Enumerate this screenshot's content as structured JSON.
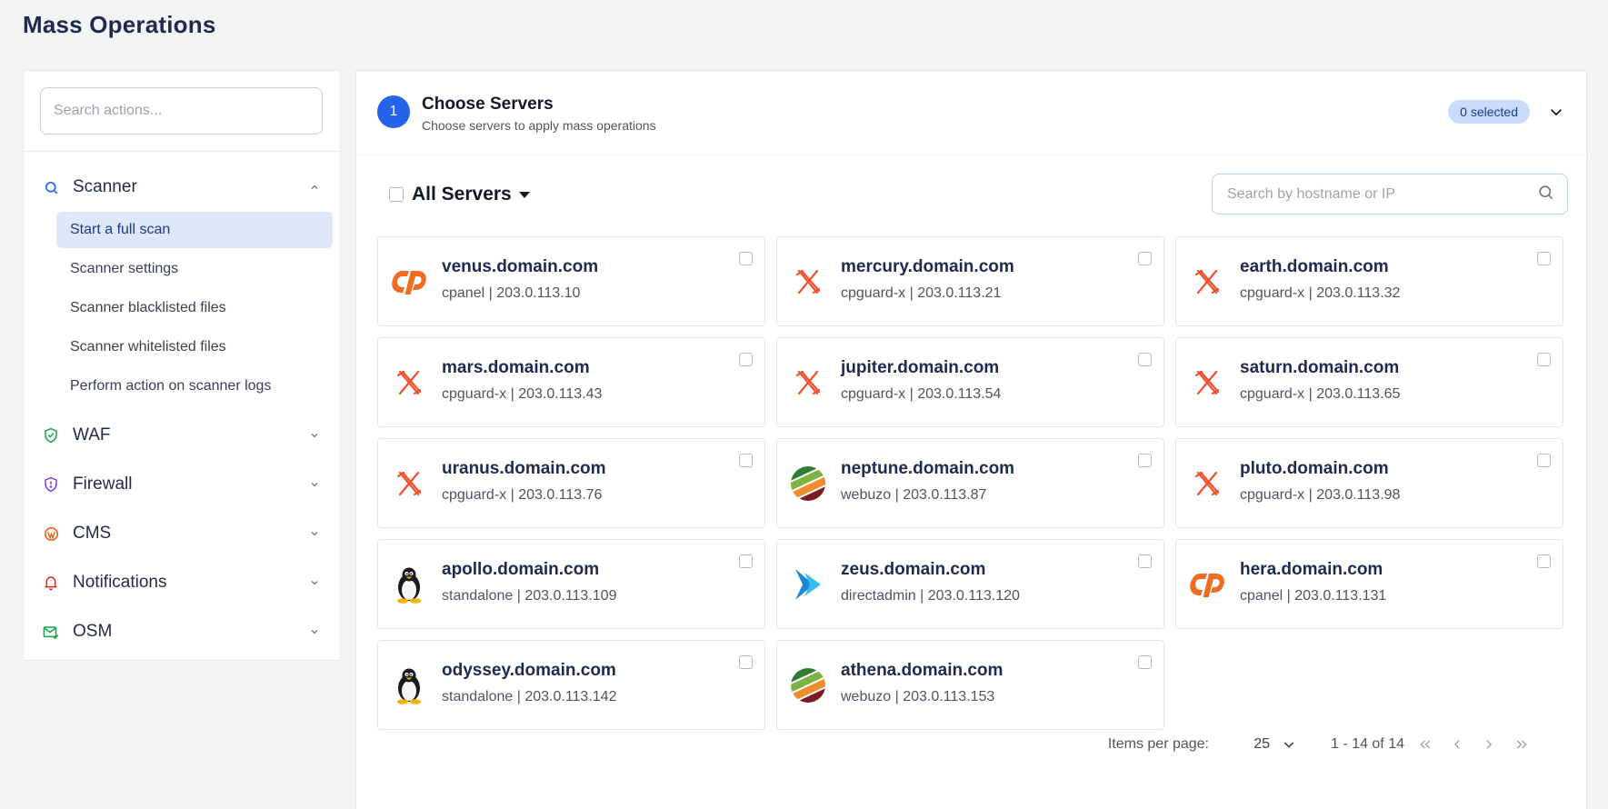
{
  "page": {
    "title": "Mass Operations"
  },
  "sidebar": {
    "search_placeholder": "Search actions...",
    "sections": [
      {
        "label": "Scanner",
        "icon": "search-icon",
        "expanded": true,
        "items": [
          {
            "label": "Start a full scan",
            "active": true
          },
          {
            "label": "Scanner settings"
          },
          {
            "label": "Scanner blacklisted files"
          },
          {
            "label": "Scanner whitelisted files"
          },
          {
            "label": "Perform action on scanner logs"
          }
        ]
      },
      {
        "label": "WAF",
        "icon": "shield-check-icon",
        "expanded": false
      },
      {
        "label": "Firewall",
        "icon": "shield-alert-icon",
        "expanded": false
      },
      {
        "label": "CMS",
        "icon": "wordpress-icon",
        "expanded": false
      },
      {
        "label": "Notifications",
        "icon": "bell-icon",
        "expanded": false
      },
      {
        "label": "OSM",
        "icon": "mail-check-icon",
        "expanded": false
      }
    ]
  },
  "step": {
    "number": "1",
    "title": "Choose Servers",
    "subtitle": "Choose servers to apply mass operations",
    "selected_badge": "0 selected"
  },
  "filter": {
    "all_servers_label": "All Servers",
    "search_placeholder": "Search by hostname or IP"
  },
  "servers": [
    {
      "host": "venus.domain.com",
      "meta": "cpanel | 203.0.113.10",
      "logo": "cpanel"
    },
    {
      "host": "mercury.domain.com",
      "meta": "cpguard-x | 203.0.113.21",
      "logo": "cpguard"
    },
    {
      "host": "earth.domain.com",
      "meta": "cpguard-x | 203.0.113.32",
      "logo": "cpguard"
    },
    {
      "host": "mars.domain.com",
      "meta": "cpguard-x | 203.0.113.43",
      "logo": "cpguard"
    },
    {
      "host": "jupiter.domain.com",
      "meta": "cpguard-x | 203.0.113.54",
      "logo": "cpguard"
    },
    {
      "host": "saturn.domain.com",
      "meta": "cpguard-x | 203.0.113.65",
      "logo": "cpguard"
    },
    {
      "host": "uranus.domain.com",
      "meta": "cpguard-x | 203.0.113.76",
      "logo": "cpguard"
    },
    {
      "host": "neptune.domain.com",
      "meta": "webuzo | 203.0.113.87",
      "logo": "webuzo"
    },
    {
      "host": "pluto.domain.com",
      "meta": "cpguard-x | 203.0.113.98",
      "logo": "cpguard"
    },
    {
      "host": "apollo.domain.com",
      "meta": "standalone | 203.0.113.109",
      "logo": "linux"
    },
    {
      "host": "zeus.domain.com",
      "meta": "directadmin | 203.0.113.120",
      "logo": "directadmin"
    },
    {
      "host": "hera.domain.com",
      "meta": "cpanel | 203.0.113.131",
      "logo": "cpanel"
    },
    {
      "host": "odyssey.domain.com",
      "meta": "standalone | 203.0.113.142",
      "logo": "linux"
    },
    {
      "host": "athena.domain.com",
      "meta": "webuzo | 203.0.113.153",
      "logo": "webuzo"
    }
  ],
  "pagination": {
    "items_per_page_label": "Items per page:",
    "items_per_page": "25",
    "range": "1 - 14 of 14"
  },
  "colors": {
    "primary": "#2563eb",
    "active_bg": "#dde8fb",
    "cpanel_orange": "#f26b21",
    "cpguard_red": "#f0502f"
  }
}
